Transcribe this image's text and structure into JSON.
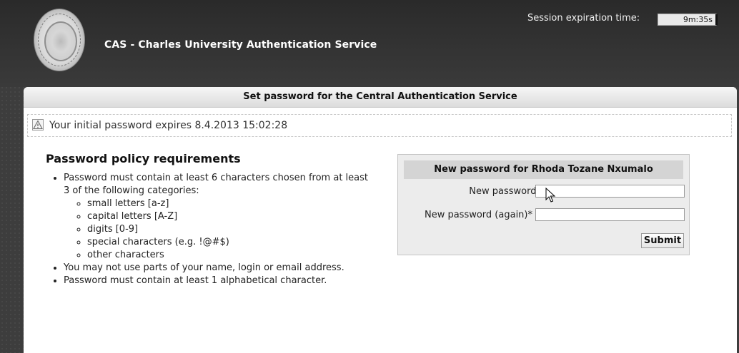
{
  "header": {
    "app_title": "CAS - Charles University Authentication Service",
    "session_label": "Session expiration time:",
    "session_value": "9m:35s",
    "logo_icon": "university-seal-icon"
  },
  "panel": {
    "title": "Set password for the Central Authentication Service",
    "notice": {
      "icon": "warning-triangle-icon",
      "text": "Your initial password expires 8.4.2013 15:02:28"
    }
  },
  "policy": {
    "heading": "Password policy requirements",
    "rule1": "Password must contain at least 6 characters chosen from at least 3 of the following categories:",
    "categories": [
      "small letters [a-z]",
      "capital letters [A-Z]",
      "digits [0-9]",
      "special characters (e.g. !@#$)",
      "other characters"
    ],
    "rule2": "You may not use parts of your name, login or email address.",
    "rule3": "Password must contain at least 1 alphabetical character."
  },
  "form": {
    "title": "New password for Rhoda Tozane Nxumalo",
    "new_password_label": "New password*",
    "new_password_value": "",
    "new_password_again_label": "New password (again)*",
    "new_password_again_value": "",
    "submit_label": "Submit"
  },
  "colors": {
    "background": "#3d3d3d",
    "panel": "#ffffff",
    "form_box": "#ececec"
  }
}
